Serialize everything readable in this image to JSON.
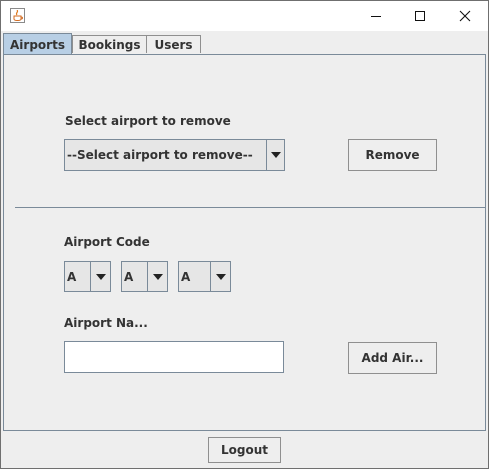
{
  "window": {
    "icon": "java-cup-icon",
    "controls": [
      "minimize-icon",
      "maximize-icon",
      "close-icon"
    ]
  },
  "tabs": [
    {
      "label": "Airports",
      "active": true
    },
    {
      "label": "Bookings",
      "active": false
    },
    {
      "label": "Users",
      "active": false
    }
  ],
  "remove_section": {
    "label": "Select airport to remove",
    "combo_value": "--Select airport to remove--",
    "button": "Remove"
  },
  "add_section": {
    "code_label": "Airport Code",
    "code_letters": [
      "A",
      "A",
      "A"
    ],
    "name_label": "Airport Na...",
    "name_value": "",
    "button": "Add Air..."
  },
  "footer": {
    "logout": "Logout"
  },
  "colors": {
    "active_tab": "#b8cfe5",
    "border": "#7a8a99",
    "background": "#eeeeee"
  }
}
